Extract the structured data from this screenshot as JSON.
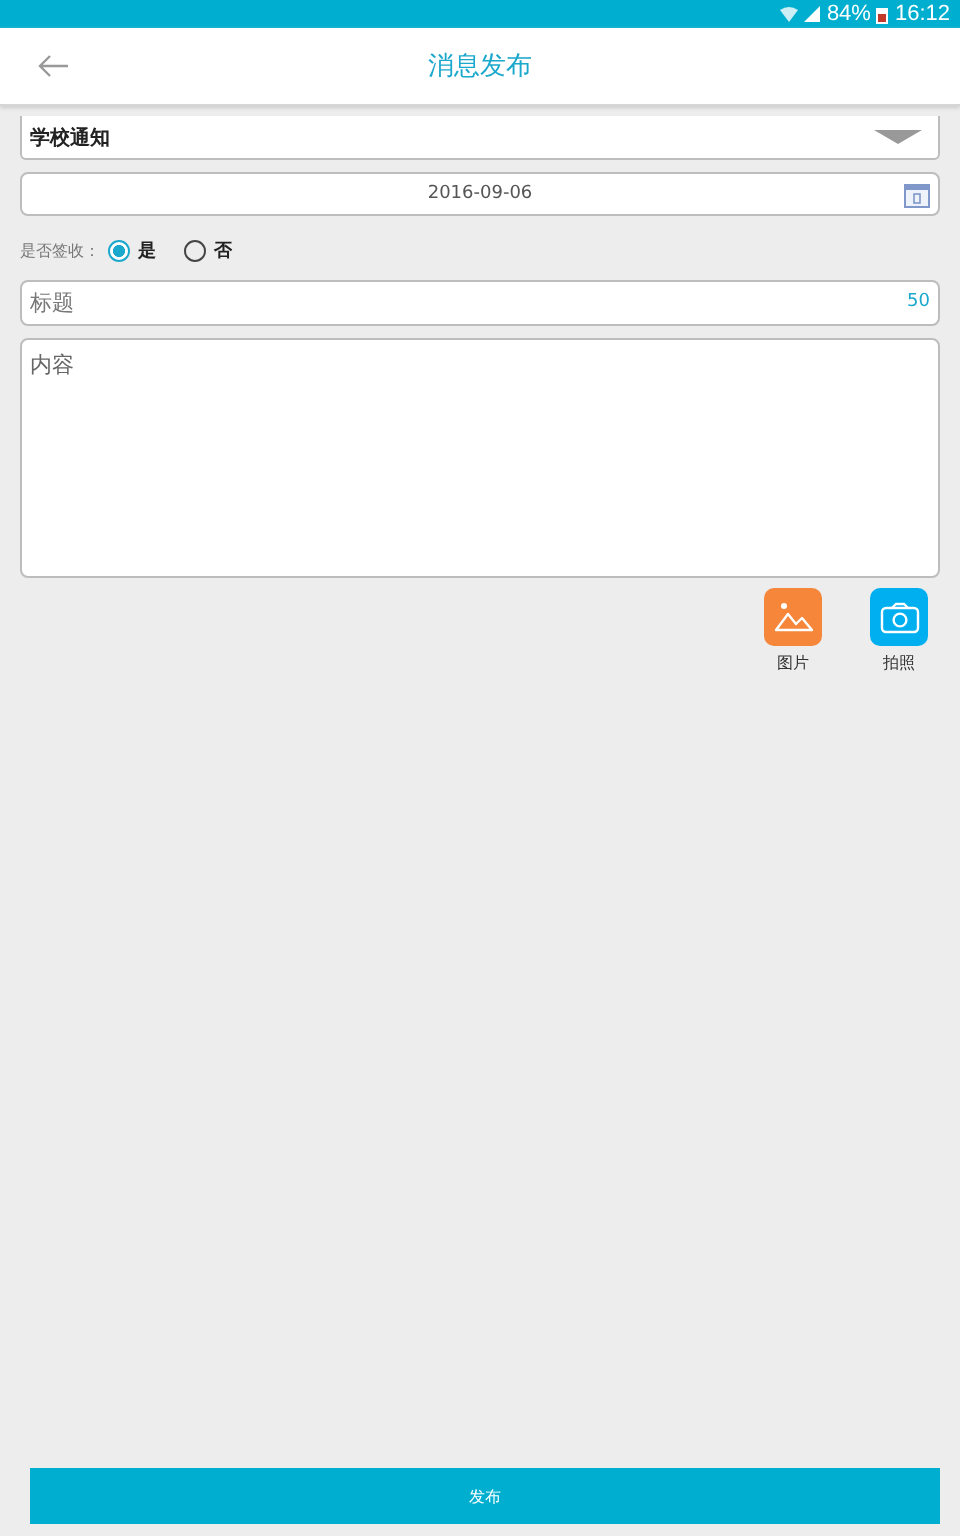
{
  "status_bar": {
    "battery": "84%",
    "time": "16:12"
  },
  "header": {
    "title": "消息发布"
  },
  "category": {
    "value": "学校通知"
  },
  "date": {
    "value": "2016-09-06"
  },
  "receipt": {
    "label": "是否签收：",
    "options": [
      {
        "label": "是",
        "selected": true
      },
      {
        "label": "否",
        "selected": false
      }
    ]
  },
  "title_field": {
    "placeholder": "标题",
    "counter": "50"
  },
  "content_field": {
    "placeholder": "内容"
  },
  "attachments": [
    {
      "kind": "image",
      "label": "图片"
    },
    {
      "kind": "camera",
      "label": "拍照"
    }
  ],
  "publish_button": {
    "label": "发布"
  }
}
